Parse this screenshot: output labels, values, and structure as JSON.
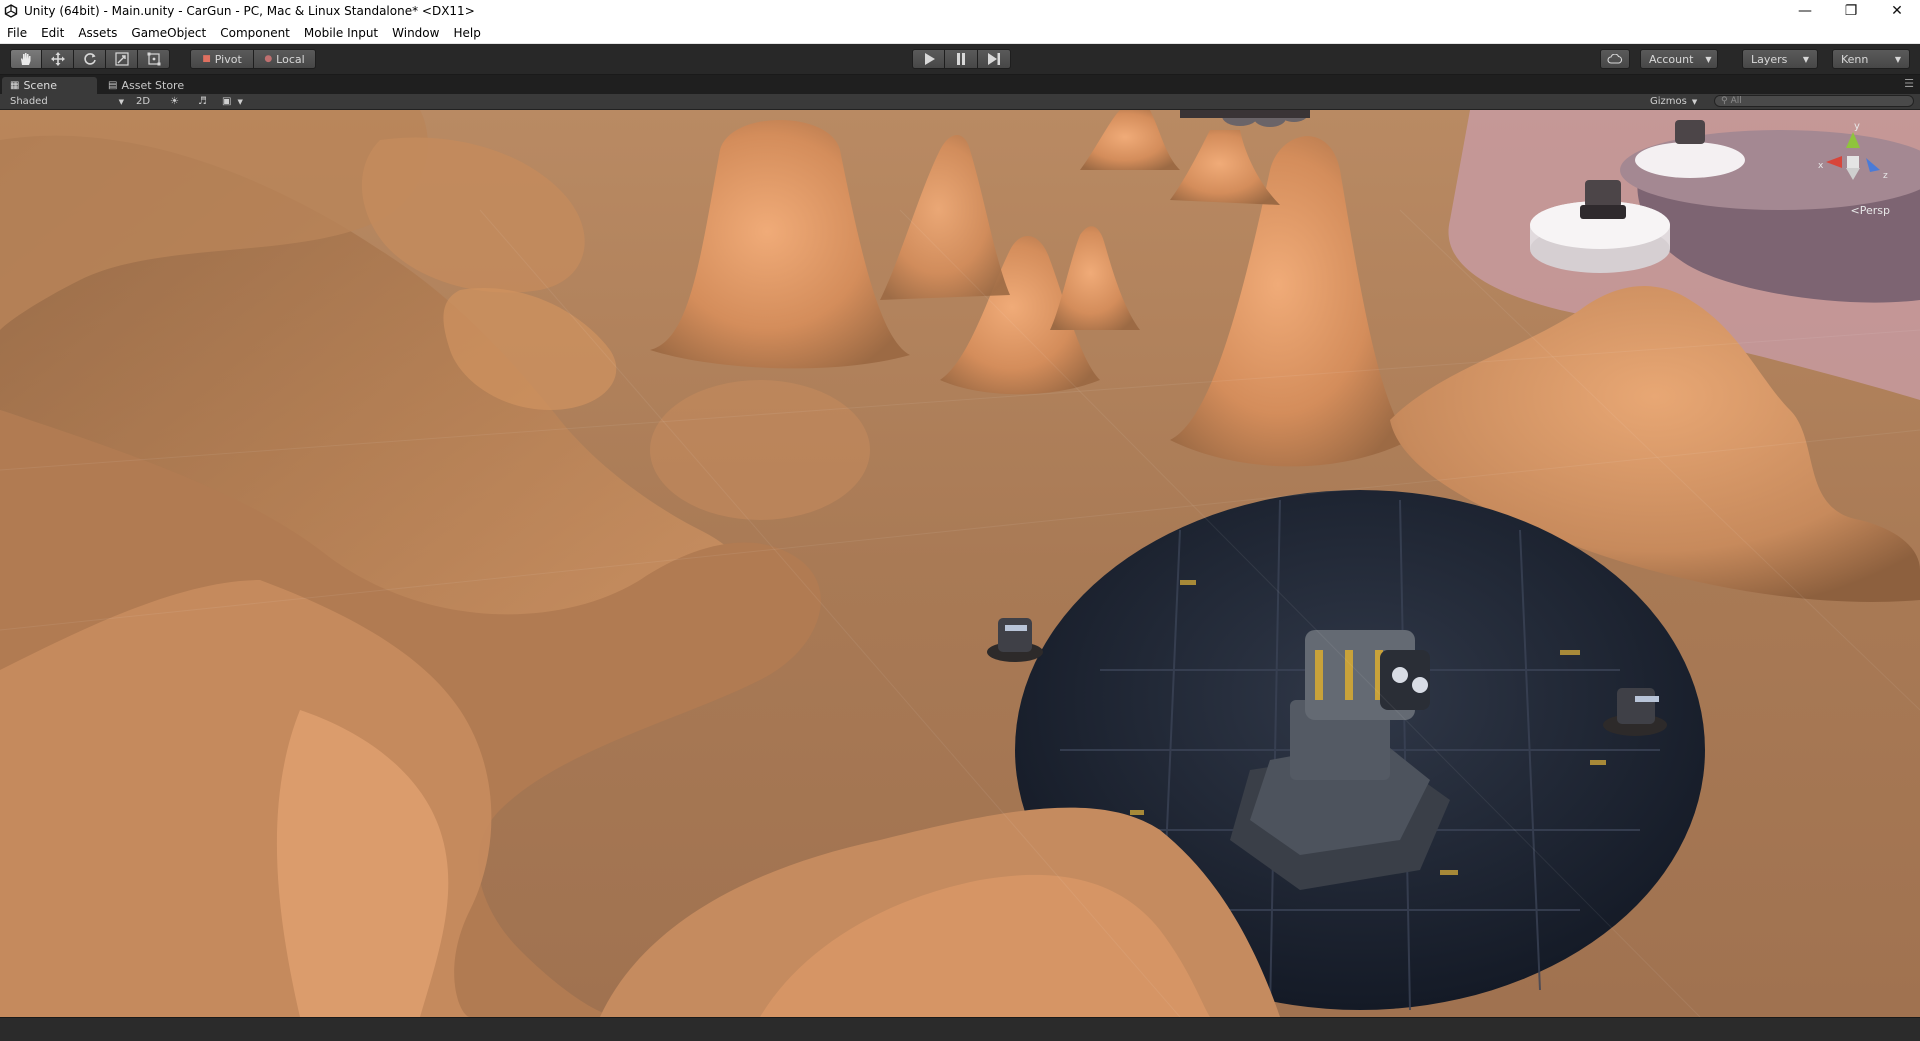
{
  "window": {
    "title": "Unity (64bit) - Main.unity - CarGun - PC, Mac & Linux Standalone* <DX11>",
    "controls": [
      "minimize-icon",
      "restore-icon",
      "close-icon"
    ]
  },
  "menu": {
    "items": [
      "File",
      "Edit",
      "Assets",
      "GameObject",
      "Component",
      "Mobile Input",
      "Window",
      "Help"
    ]
  },
  "toolbar": {
    "transform_tools": [
      "hand-tool-icon",
      "move-tool-icon",
      "rotate-tool-icon",
      "scale-tool-icon",
      "rect-tool-icon"
    ],
    "pivot_label": "Pivot",
    "local_label": "Local",
    "play_controls": [
      "play-icon",
      "pause-icon",
      "step-icon"
    ],
    "account_label": "Account",
    "layers_label": "Layers",
    "layout_label": "Kenn"
  },
  "tabs": {
    "scene_label": "Scene",
    "asset_store_label": "Asset Store"
  },
  "scene_view": {
    "shading_mode": "Shaded",
    "mode_2d": "2D",
    "gizmos_label": "Gizmos",
    "search_placeholder": "All",
    "projection_label": "Persp",
    "axis_labels": {
      "y": "y",
      "x": "x",
      "z": "z"
    }
  },
  "colors": {
    "sand": "#c58b5f",
    "sand_light": "#e9a46f",
    "sand_dark": "#7a5135",
    "platform_dark": "#1c2230",
    "toolbar_bg": "#282828",
    "axis_x": "#d8453a",
    "axis_y": "#8fc43c",
    "axis_z": "#4a7bd8"
  }
}
